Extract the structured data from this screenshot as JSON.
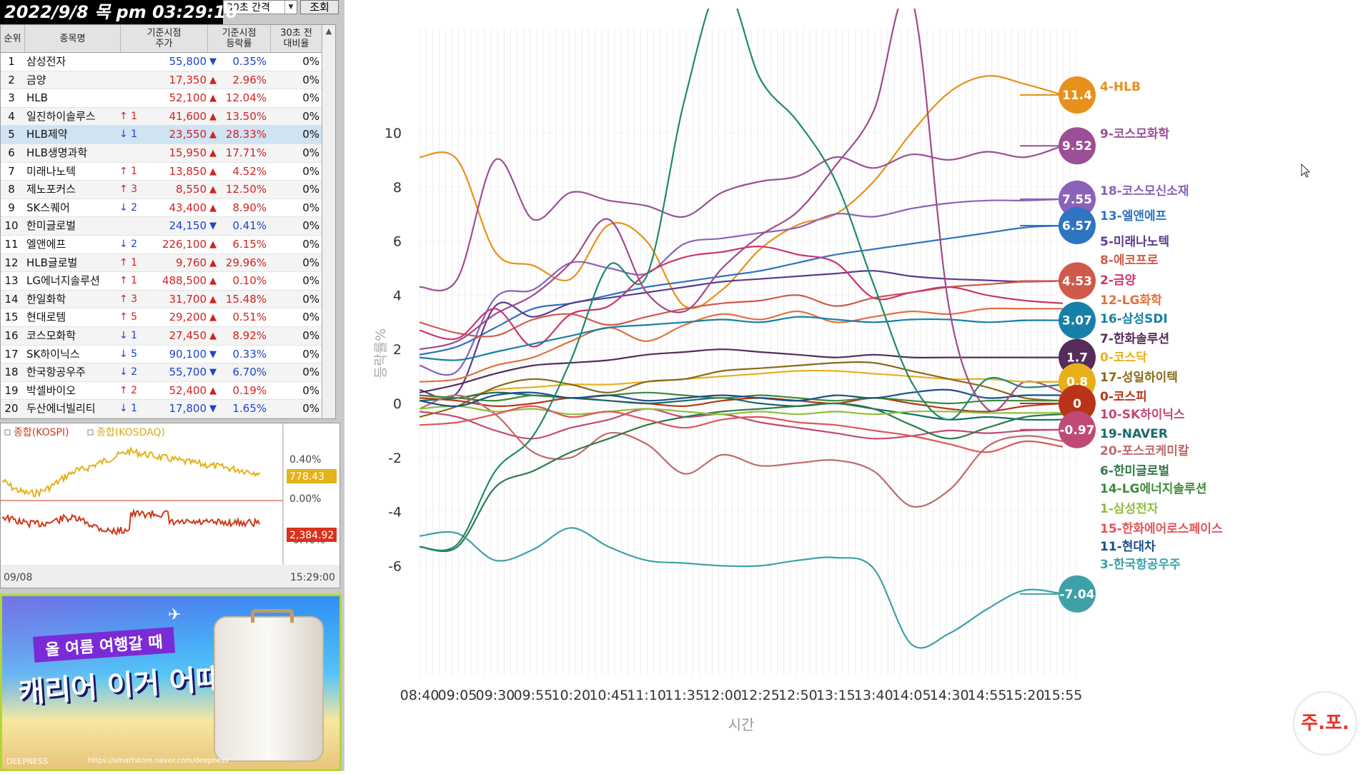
{
  "clock": "2022/9/8 목 pm 03:29:10",
  "interval_label": "30초 간격",
  "query_button": "조회",
  "table": {
    "headers": [
      "순위",
      "종목명",
      "기준시점\n주가",
      "기준시점\n등락률",
      "30초 전\n대비율"
    ],
    "rows": [
      {
        "rank": "1",
        "name": "삼성전자",
        "chg": "",
        "chg_dir": "",
        "price": "55,800",
        "dir": "down",
        "pct": "0.35%",
        "vs": "0%"
      },
      {
        "rank": "2",
        "name": "금양",
        "chg": "",
        "chg_dir": "",
        "price": "17,350",
        "dir": "up",
        "pct": "2.96%",
        "vs": "0%"
      },
      {
        "rank": "3",
        "name": "HLB",
        "chg": "",
        "chg_dir": "",
        "price": "52,100",
        "dir": "up",
        "pct": "12.04%",
        "vs": "0%"
      },
      {
        "rank": "4",
        "name": "일진하이솔루스",
        "chg": "↑ 1",
        "chg_dir": "up",
        "price": "41,600",
        "dir": "up",
        "pct": "13.50%",
        "vs": "0%"
      },
      {
        "rank": "5",
        "name": "HLB제약",
        "chg": "↓ 1",
        "chg_dir": "down",
        "price": "23,550",
        "dir": "up",
        "pct": "28.33%",
        "vs": "0%",
        "selected": true
      },
      {
        "rank": "6",
        "name": "HLB생명과학",
        "chg": "",
        "chg_dir": "",
        "price": "15,950",
        "dir": "up",
        "pct": "17.71%",
        "vs": "0%"
      },
      {
        "rank": "7",
        "name": "미래나노텍",
        "chg": "↑ 1",
        "chg_dir": "up",
        "price": "13,850",
        "dir": "up",
        "pct": "4.52%",
        "vs": "0%"
      },
      {
        "rank": "8",
        "name": "제노포커스",
        "chg": "↑ 3",
        "chg_dir": "up",
        "price": "8,550",
        "dir": "up",
        "pct": "12.50%",
        "vs": "0%"
      },
      {
        "rank": "9",
        "name": "SK스퀘어",
        "chg": "↓ 2",
        "chg_dir": "down",
        "price": "43,400",
        "dir": "up",
        "pct": "8.90%",
        "vs": "0%"
      },
      {
        "rank": "10",
        "name": "한미글로벌",
        "chg": "",
        "chg_dir": "",
        "price": "24,150",
        "dir": "down",
        "pct": "0.41%",
        "vs": "0%"
      },
      {
        "rank": "11",
        "name": "엘앤에프",
        "chg": "↓ 2",
        "chg_dir": "down",
        "price": "226,100",
        "dir": "up",
        "pct": "6.15%",
        "vs": "0%"
      },
      {
        "rank": "12",
        "name": "HLB글로벌",
        "chg": "↑ 1",
        "chg_dir": "up",
        "price": "9,760",
        "dir": "up",
        "pct": "29.96%",
        "vs": "0%"
      },
      {
        "rank": "13",
        "name": "LG에너지솔루션",
        "chg": "↑ 1",
        "chg_dir": "up",
        "price": "488,500",
        "dir": "up",
        "pct": "0.10%",
        "vs": "0%"
      },
      {
        "rank": "14",
        "name": "한일화학",
        "chg": "↑ 3",
        "chg_dir": "up",
        "price": "31,700",
        "dir": "up",
        "pct": "15.48%",
        "vs": "0%"
      },
      {
        "rank": "15",
        "name": "현대로템",
        "chg": "↑ 5",
        "chg_dir": "up",
        "price": "29,200",
        "dir": "up",
        "pct": "0.51%",
        "vs": "0%"
      },
      {
        "rank": "16",
        "name": "코스모화학",
        "chg": "↓ 1",
        "chg_dir": "down",
        "price": "27,450",
        "dir": "up",
        "pct": "8.92%",
        "vs": "0%"
      },
      {
        "rank": "17",
        "name": "SK하이닉스",
        "chg": "↓ 5",
        "chg_dir": "down",
        "price": "90,100",
        "dir": "down",
        "pct": "0.33%",
        "vs": "0%"
      },
      {
        "rank": "18",
        "name": "한국항공우주",
        "chg": "↓ 2",
        "chg_dir": "down",
        "price": "55,700",
        "dir": "down",
        "pct": "6.70%",
        "vs": "0%"
      },
      {
        "rank": "19",
        "name": "박셀바이오",
        "chg": "↑ 2",
        "chg_dir": "up",
        "price": "52,400",
        "dir": "up",
        "pct": "0.19%",
        "vs": "0%"
      },
      {
        "rank": "20",
        "name": "두산에너빌리티",
        "chg": "↓ 1",
        "chg_dir": "down",
        "price": "17,800",
        "dir": "down",
        "pct": "1.65%",
        "vs": "0%"
      }
    ]
  },
  "mini_chart": {
    "legend_kospi": "종합(KOSPI)",
    "legend_kosdaq": "종합(KOSDAQ)",
    "label_top": "0.40%",
    "label_zero": "0.00%",
    "label_bottom": "-0.40%",
    "kosdaq_value": "778.43",
    "kospi_value": "2,384.92",
    "date": "09/08",
    "time": "15:29:00",
    "colors": {
      "kospi": "#cc3a1a",
      "kosdaq": "#e3b21d"
    }
  },
  "ad": {
    "tagline": "올 여름 여행갈 때",
    "headline": "캐리어 이거 어때?",
    "brand": "DEEPNESS",
    "url": "https://smartstore.naver.com/deepness"
  },
  "logo_text": "주.포.",
  "chart_data": {
    "type": "line",
    "ylabel": "등락률%",
    "xlabel": "시간",
    "ylim": [
      -10,
      14
    ],
    "yticks": [
      10,
      8,
      6,
      4,
      2,
      0,
      -2,
      -4,
      -6
    ],
    "x": [
      "08:40",
      "09:05",
      "09:30",
      "09:55",
      "10:20",
      "10:45",
      "11:10",
      "11:35",
      "12:00",
      "12:25",
      "12:50",
      "13:15",
      "13:40",
      "14:05",
      "14:30",
      "14:55",
      "15:20",
      "15:55"
    ],
    "series": [
      {
        "name": "4-HLB",
        "color": "#e8901c",
        "badge": "11.4",
        "values": [
          9.1,
          9.0,
          5.6,
          5.1,
          4.6,
          6.6,
          6.0,
          3.6,
          4.2,
          5.7,
          6.6,
          7.0,
          8.2,
          10.0,
          11.5,
          12.1,
          11.8,
          11.4
        ]
      },
      {
        "name": "9-코스모화학",
        "color": "#9a4f96",
        "badge": "9.52",
        "values": [
          4.3,
          4.6,
          9.0,
          6.8,
          7.8,
          7.5,
          7.3,
          6.9,
          7.8,
          8.2,
          8.4,
          9.1,
          8.7,
          9.2,
          9.0,
          9.3,
          9.1,
          9.52
        ]
      },
      {
        "name": "18-코스모신소재",
        "color": "#8a62b8",
        "badge": "7.55",
        "values": [
          1.4,
          1.2,
          3.9,
          4.2,
          5.2,
          5.0,
          4.8,
          5.9,
          6.1,
          6.3,
          6.5,
          7.0,
          6.9,
          7.2,
          7.4,
          7.5,
          7.5,
          7.55
        ]
      },
      {
        "name": "13-엘앤에프",
        "color": "#2f74c0",
        "badge": "6.57",
        "values": [
          1.8,
          2.1,
          2.8,
          3.5,
          3.7,
          4.0,
          4.3,
          4.5,
          4.7,
          4.9,
          5.2,
          5.5,
          5.7,
          5.9,
          6.1,
          6.3,
          6.5,
          6.57
        ]
      },
      {
        "name": "5-미래나노텍",
        "color": "#5c3a8f",
        "badge": "",
        "values": [
          0.5,
          0.4,
          3.6,
          3.2,
          3.7,
          3.9,
          4.1,
          4.3,
          4.5,
          4.6,
          4.7,
          4.8,
          4.9,
          4.7,
          4.6,
          4.55,
          4.5,
          4.53
        ]
      },
      {
        "name": "8-에코프로",
        "color": "#d05a4a",
        "badge": "4.53",
        "values": [
          3.0,
          2.6,
          2.5,
          3.1,
          3.3,
          2.9,
          3.2,
          3.5,
          3.7,
          3.8,
          4.0,
          3.6,
          3.9,
          4.1,
          4.3,
          4.4,
          4.5,
          4.53
        ]
      },
      {
        "name": "2-금양",
        "color": "#c8366e",
        "badge": "",
        "values": [
          2.7,
          2.4,
          3.5,
          2.1,
          3.3,
          3.6,
          4.8,
          5.4,
          5.6,
          5.8,
          5.5,
          5.2,
          3.9,
          4.1,
          4.3,
          4.0,
          3.8,
          3.7
        ]
      },
      {
        "name": "12-LG화학",
        "color": "#e07040",
        "badge": "",
        "values": [
          0.8,
          0.9,
          1.4,
          1.7,
          2.3,
          2.8,
          2.3,
          2.9,
          3.3,
          3.1,
          3.4,
          3.0,
          3.2,
          3.4,
          3.3,
          3.5,
          3.5,
          3.5
        ]
      },
      {
        "name": "16-삼성SDI",
        "color": "#1780a8",
        "badge": "3.07",
        "values": [
          1.7,
          1.6,
          1.9,
          2.2,
          2.5,
          2.8,
          2.9,
          3.0,
          3.1,
          3.0,
          3.2,
          3.1,
          3.0,
          3.1,
          3.1,
          3.0,
          3.07,
          3.07
        ]
      },
      {
        "name": "7-한화솔루션",
        "color": "#552c5a",
        "badge": "1.7",
        "values": [
          0.4,
          0.7,
          1.1,
          1.4,
          1.5,
          1.6,
          1.8,
          1.9,
          2.0,
          1.9,
          1.8,
          1.7,
          1.8,
          1.7,
          1.7,
          1.7,
          1.7,
          1.7
        ]
      },
      {
        "name": "0-코스닥",
        "color": "#e7b01a",
        "badge": "0.8",
        "values": [
          0.3,
          0.2,
          0.5,
          0.6,
          0.7,
          0.7,
          0.8,
          0.9,
          1.0,
          1.1,
          1.2,
          1.2,
          1.1,
          1.0,
          0.9,
          0.9,
          0.8,
          0.8
        ]
      },
      {
        "name": "17-성일하이텍",
        "color": "#8a6a1a",
        "badge": "",
        "values": [
          -0.5,
          -0.1,
          0.6,
          0.9,
          0.7,
          0.4,
          0.8,
          0.9,
          1.2,
          1.3,
          1.4,
          1.5,
          1.5,
          1.2,
          0.9,
          0.6,
          0.2,
          0.1
        ]
      },
      {
        "name": "0-코스피",
        "color": "#b83418",
        "badge": "0",
        "values": [
          0.2,
          0.1,
          -0.1,
          0.0,
          0.2,
          0.1,
          0.0,
          -0.1,
          0.1,
          0.2,
          0.1,
          0.0,
          0.2,
          0.0,
          -0.2,
          -0.3,
          -0.1,
          0.0
        ]
      },
      {
        "name": "10-SK하이닉스",
        "color": "#c04a76",
        "badge": "-0.97",
        "values": [
          -0.3,
          -0.5,
          -1.0,
          -1.3,
          -0.9,
          -0.6,
          -0.2,
          -0.5,
          -0.4,
          -0.7,
          -0.9,
          -1.1,
          -1.3,
          -1.2,
          -1.0,
          -1.1,
          -1.0,
          -0.97
        ]
      },
      {
        "name": "19-NAVER",
        "color": "#1b6a6a",
        "badge": "",
        "values": [
          0.1,
          0.2,
          0.4,
          0.3,
          0.2,
          0.1,
          0.0,
          0.1,
          0.2,
          0.0,
          -0.1,
          0.0,
          -0.2,
          -0.4,
          -0.6,
          -0.5,
          -0.6,
          -0.6
        ]
      },
      {
        "name": "20-포스코케미칼",
        "color": "#c06a6a",
        "badge": "",
        "values": [
          -0.2,
          0.3,
          -0.4,
          -1.8,
          -2.0,
          -1.1,
          -1.5,
          -2.6,
          -1.9,
          -2.3,
          -2.2,
          -2.1,
          -2.5,
          -3.8,
          -3.2,
          -1.6,
          -1.2,
          -1.4
        ]
      },
      {
        "name": "6-한미글로벌",
        "color": "#2f7a4a",
        "badge": "",
        "values": [
          -5.3,
          -5.3,
          -3.1,
          -2.5,
          -1.8,
          -1.3,
          -0.8,
          -0.5,
          -0.3,
          -0.2,
          -0.1,
          0.0,
          -0.2,
          -0.8,
          -1.3,
          -0.9,
          -0.5,
          -0.4
        ]
      },
      {
        "name": "14-LG에너지솔루션",
        "color": "#3e8a3a",
        "badge": "",
        "values": [
          0.3,
          0.2,
          0.1,
          0.3,
          0.2,
          0.3,
          0.4,
          0.3,
          0.2,
          0.3,
          0.2,
          0.1,
          0.2,
          0.1,
          0.0,
          0.1,
          0.1,
          0.1
        ]
      },
      {
        "name": "1-삼성전자",
        "color": "#8fbf3a",
        "badge": "",
        "values": [
          -0.2,
          -0.1,
          -0.3,
          -0.2,
          -0.4,
          -0.3,
          -0.2,
          -0.3,
          -0.4,
          -0.3,
          -0.4,
          -0.3,
          -0.4,
          -0.3,
          -0.3,
          -0.35,
          -0.35,
          -0.35
        ]
      },
      {
        "name": "15-한화에어로스페이스",
        "color": "#e0555a",
        "badge": "",
        "values": [
          -0.8,
          -0.7,
          -0.4,
          -0.1,
          -0.5,
          -0.3,
          -0.6,
          -0.9,
          -0.6,
          -0.5,
          -0.7,
          -0.8,
          -1.0,
          -1.2,
          -1.5,
          -1.8,
          -1.4,
          -1.6
        ]
      },
      {
        "name": "11-현대차",
        "color": "#1b4f8a",
        "badge": "",
        "values": [
          0.1,
          -0.1,
          0.3,
          0.4,
          0.2,
          0.3,
          0.1,
          0.2,
          0.3,
          0.2,
          0.1,
          0.3,
          0.2,
          0.4,
          0.5,
          0.2,
          0.3,
          0.3
        ]
      },
      {
        "name": "3-한국항공우주",
        "color": "#3fa1a8",
        "badge": "-7.04",
        "values": [
          -4.9,
          -4.8,
          -5.8,
          -5.4,
          -4.6,
          -5.3,
          -5.8,
          -5.9,
          -6.0,
          -6.0,
          -5.8,
          -5.7,
          -6.1,
          -8.9,
          -8.5,
          -7.6,
          -6.9,
          -7.04
        ]
      },
      {
        "name": "HLB생명과학",
        "color": "#1f8a6a",
        "badge": "",
        "values": [
          -5.3,
          -5.2,
          -2.5,
          -1.2,
          1.6,
          5.1,
          4.7,
          11.2,
          15.5,
          12.0,
          10.4,
          8.2,
          4.4,
          0.8,
          -0.6,
          0.9,
          0.6,
          0.7
        ]
      },
      {
        "name": "HLB제약",
        "color": "#a04a8a",
        "badge": "",
        "values": [
          2.0,
          2.3,
          3.3,
          4.0,
          5.2,
          6.8,
          4.1,
          3.4,
          5.0,
          6.2,
          7.1,
          8.8,
          10.8,
          15.0,
          3.5,
          -0.2,
          0.8,
          0.4
        ]
      }
    ]
  }
}
